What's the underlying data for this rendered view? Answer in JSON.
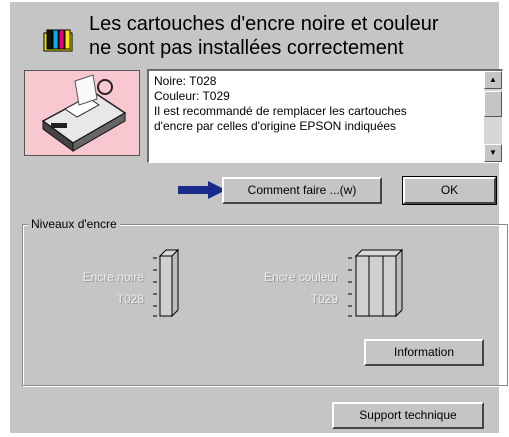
{
  "title": {
    "line1": "Les cartouches d'encre noire et couleur",
    "line2": "ne sont pas installées correctement"
  },
  "message": {
    "text": "Noire: T028\nCouleur: T029\nIl est recommandé de remplacer les cartouches\nd'encre par celles d'origine EPSON indiquées"
  },
  "buttons": {
    "how_to": "Comment faire ...(w)",
    "ok": "OK",
    "information": "Information",
    "support": "Support technique"
  },
  "ink_levels": {
    "group_label": "Niveaux d'encre",
    "black": {
      "name": "Encre noire",
      "code": "T028"
    },
    "color": {
      "name": "Encre couleur",
      "code": "T029"
    }
  },
  "icons": [
    "ink-cartridges-icon",
    "printer-icon",
    "arrow-right-icon"
  ],
  "colors": {
    "dialog": "#c5c5c5",
    "arrow": "#1a2a8c",
    "printer_bg": "#f7c8cf"
  }
}
